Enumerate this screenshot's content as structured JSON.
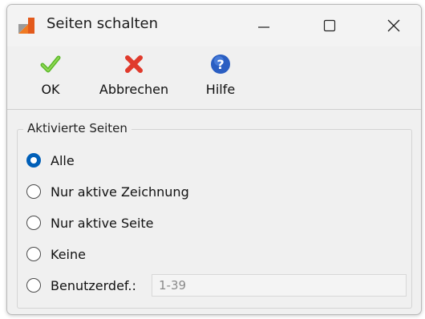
{
  "window": {
    "title": "Seiten schalten",
    "controls": {
      "minimize": "minimize-icon",
      "maximize": "maximize-icon",
      "close": "close-icon"
    }
  },
  "toolbar": {
    "ok_label": "OK",
    "cancel_label": "Abbrechen",
    "help_label": "Hilfe",
    "icons": {
      "ok": "checkmark-icon",
      "cancel": "red-x-icon",
      "help": "question-mark-icon"
    }
  },
  "group": {
    "title": "Aktivierte Seiten",
    "options": [
      {
        "label": "Alle",
        "checked": true
      },
      {
        "label": "Nur aktive Zeichnung",
        "checked": false
      },
      {
        "label": "Nur aktive Seite",
        "checked": false
      },
      {
        "label": "Keine",
        "checked": false
      },
      {
        "label": "Benutzerdef.:",
        "checked": false
      }
    ],
    "custom_range_value": "1-39"
  },
  "colors": {
    "accent": "#005fb8",
    "ok_green": "#5bb82a",
    "cancel_red": "#e03a2c",
    "help_blue": "#2a5ec2",
    "window_bg": "#f0f0f0"
  }
}
